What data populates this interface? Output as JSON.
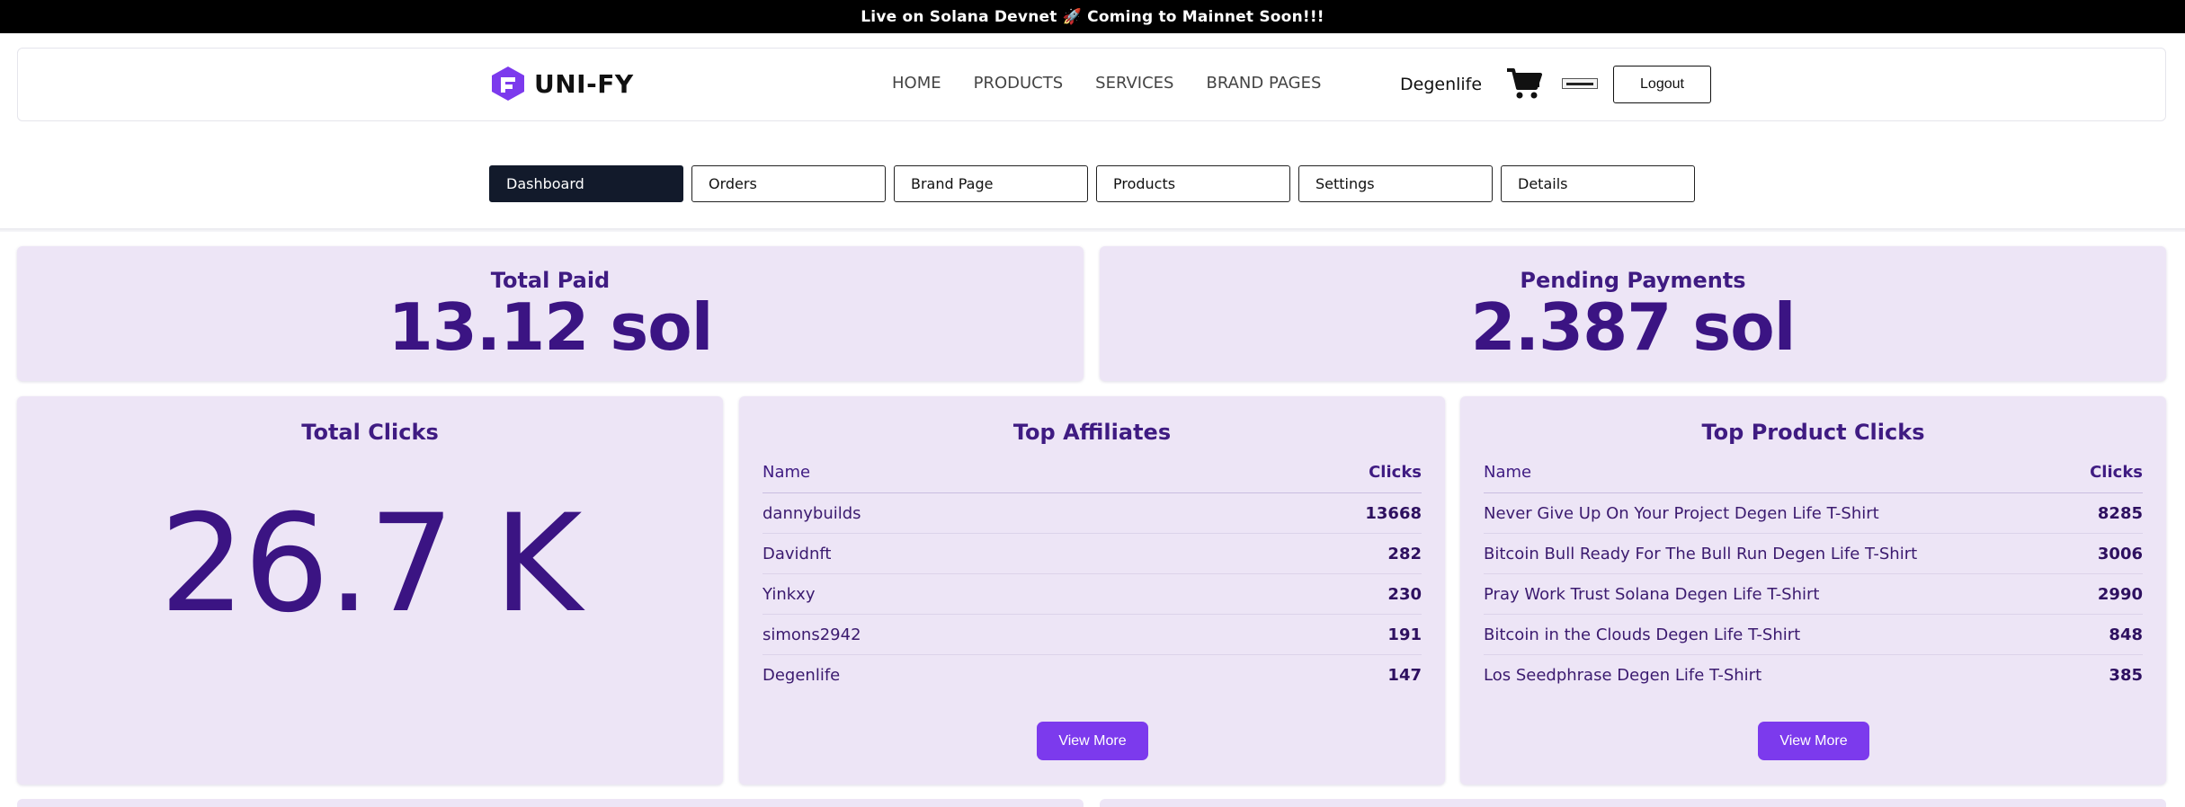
{
  "banner": {
    "text": "Live on Solana Devnet 🚀 Coming to Mainnet Soon!!!"
  },
  "header": {
    "logo_text": "UNI-FY",
    "nav": [
      "HOME",
      "PRODUCTS",
      "SERVICES",
      "BRAND PAGES"
    ],
    "user_name": "Degenlife",
    "logout_label": "Logout"
  },
  "tabs": [
    "Dashboard",
    "Orders",
    "Brand Page",
    "Products",
    "Settings",
    "Details"
  ],
  "stats": {
    "total_paid_label": "Total Paid",
    "total_paid_value": "13.12 sol",
    "pending_label": "Pending Payments",
    "pending_value": "2.387 sol",
    "total_clicks_label": "Total Clicks",
    "total_clicks_value": "26.7 K"
  },
  "top_affiliates": {
    "title": "Top Affiliates",
    "col_name": "Name",
    "col_clicks": "Clicks",
    "rows": [
      {
        "name": "dannybuilds",
        "clicks": "13668"
      },
      {
        "name": "Davidnft",
        "clicks": "282"
      },
      {
        "name": "Yinkxy",
        "clicks": "230"
      },
      {
        "name": "simons2942",
        "clicks": "191"
      },
      {
        "name": "Degenlife",
        "clicks": "147"
      }
    ],
    "view_more": "View More"
  },
  "top_products": {
    "title": "Top Product Clicks",
    "col_name": "Name",
    "col_clicks": "Clicks",
    "rows": [
      {
        "name": "Never Give Up On Your Project Degen Life T-Shirt",
        "clicks": "8285"
      },
      {
        "name": "Bitcoin Bull Ready For The Bull Run Degen Life T-Shirt",
        "clicks": "3006"
      },
      {
        "name": "Pray Work Trust Solana Degen Life T-Shirt",
        "clicks": "2990"
      },
      {
        "name": "Bitcoin in the Clouds Degen Life T-Shirt",
        "clicks": "848"
      },
      {
        "name": "Los Seedphrase Degen Life T-Shirt",
        "clicks": "385"
      }
    ],
    "view_more": "View More"
  },
  "icons": {
    "logo": "unify-logo-icon",
    "cart": "cart-icon",
    "brand": "brand-logo-thumbnail"
  },
  "colors": {
    "accent": "#7c3aed",
    "card_bg": "#ede5f6",
    "text_purple": "#3b1483",
    "active_tab": "#121a2b"
  }
}
